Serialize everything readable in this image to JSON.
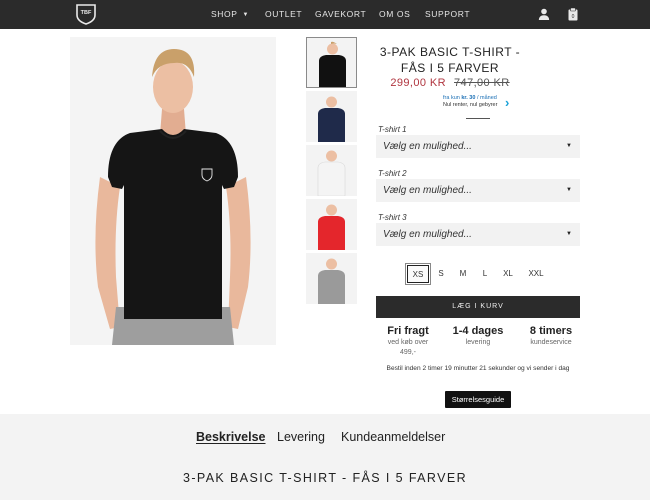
{
  "header": {
    "logo_text": "TBF",
    "nav": [
      {
        "label": "SHOP",
        "has_dropdown": true
      },
      {
        "label": "OUTLET"
      },
      {
        "label": "GAVEKORT"
      },
      {
        "label": "OM OS"
      },
      {
        "label": "SUPPORT"
      }
    ],
    "icons": [
      "user-icon",
      "cart-icon"
    ]
  },
  "product": {
    "title": "3-PAK BASIC T-SHIRT - FÅS I 5 FARVER",
    "price_new": "299,00 KR",
    "price_old": "747,00 KR",
    "finance_line1_prefix": "fra kun ",
    "finance_line1_amount": "kr. 30",
    "finance_line1_suffix": " / måned",
    "finance_line2": "Nul renter, nul gebyrer",
    "thumbnail_colors": [
      "#111111",
      "#1f2a4a",
      "#f4f4f4",
      "#e4262c",
      "#9a9a9a"
    ],
    "options": [
      {
        "label": "T-shirt 1",
        "value": "Vælg en mulighed..."
      },
      {
        "label": "T-shirt 2",
        "value": "Vælg en mulighed..."
      },
      {
        "label": "T-shirt 3",
        "value": "Vælg en mulighed..."
      }
    ],
    "sizes": [
      "XS",
      "S",
      "M",
      "L",
      "XL",
      "XXL"
    ],
    "selected_size": "XS",
    "add_to_cart": "LÆG I KURV",
    "usps": [
      {
        "title": "Fri fragt",
        "sub": "ved køb over 499,-"
      },
      {
        "title": "1-4 dages",
        "sub": "levering"
      },
      {
        "title": "8 timers",
        "sub": "kundeservice"
      }
    ],
    "order_note": "Bestil inden 2 timer 19 minutter 21 sekunder og vi sender i dag",
    "size_guide": "Størrelsesguide"
  },
  "tabs": {
    "items": [
      "Beskrivelse",
      "Levering",
      "Kundeanmeldelser"
    ],
    "active": "Beskrivelse",
    "description_title": "3-PAK BASIC T-SHIRT - FÅS I 5 FARVER"
  }
}
